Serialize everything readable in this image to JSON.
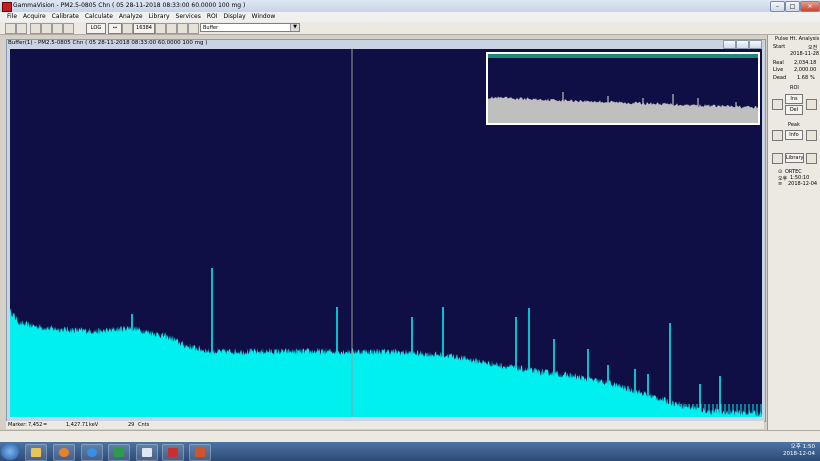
{
  "window": {
    "title": "GammaVision - PM2.5-0805 Chn ( 05 28-11-2018 08:33:00 60.0000 100 mg )"
  },
  "menu": [
    "File",
    "Acquire",
    "Calibrate",
    "Calculate",
    "Analyze",
    "Library",
    "Services",
    "ROI",
    "Display",
    "Window"
  ],
  "toolbar": {
    "scale_mode": "LOG",
    "expand_arrow": "↔",
    "channels": "16384",
    "buffer_label": "Buffer"
  },
  "child_window": {
    "title": "Buffer(1) - PM2.5-0805 Chn ( 05 28-11-2018 08:33:00 60.0000 100 mg )"
  },
  "spectrum": {
    "fill_color": "#00f0f0",
    "background": "#0f0f45",
    "marker_color": "#9a9a9a",
    "inset_band_color": "#1a8a7a",
    "inset_fill": "#bfbfbf"
  },
  "marker": {
    "label": "Marker:",
    "channel": "7,452",
    "eq": "=",
    "energy": "1,427.71",
    "energy_unit": "keV",
    "counts": "29",
    "counts_unit": "Cnts"
  },
  "panel": {
    "heading": "Pulse Ht. Analysis",
    "start_label": "Start",
    "start_time": "오전",
    "start_date": "2018-11-28",
    "real_label": "Real",
    "real_value": "2,034.18",
    "live_label": "Live",
    "live_value": "2,000.00",
    "dead_label": "Dead",
    "dead_value": "1.68",
    "dead_unit": "%",
    "roi_label": "ROI",
    "ins_label": "Ins",
    "del_label": "Del",
    "peak_label": "Peak",
    "info_label": "Info",
    "library_label": "Library",
    "vendor": "ORTEC",
    "clock_prefix": "오후",
    "clock_time": "1:50:10",
    "date_prefix": "≡",
    "date": "2018-12-04"
  },
  "taskbar": {
    "time": "오후 1:50",
    "date": "2018-12-04"
  }
}
